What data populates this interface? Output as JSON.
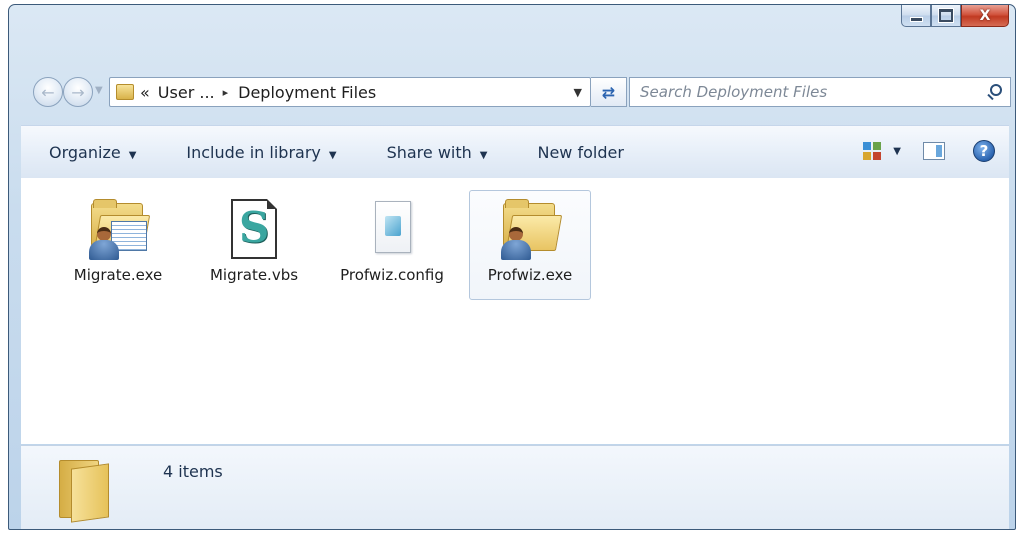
{
  "window": {
    "caption_buttons": {
      "minimize": "minimize",
      "maximize": "maximize",
      "close": "X"
    }
  },
  "navigation": {
    "back_icon": "back-arrow-icon",
    "forward_icon": "forward-arrow-icon",
    "address": {
      "prefix": "«",
      "segments": [
        "User ...",
        "Deployment Files"
      ],
      "separator": "▸"
    },
    "search": {
      "placeholder": "Search Deployment Files"
    }
  },
  "toolbar": {
    "organize": "Organize",
    "include_in_library": "Include in library",
    "share_with": "Share with",
    "new_folder": "New folder"
  },
  "files": [
    {
      "name": "Migrate.exe",
      "icon": "folder-person-doc-icon",
      "selected": false
    },
    {
      "name": "Migrate.vbs",
      "icon": "script-icon",
      "selected": false
    },
    {
      "name": "Profwiz.config",
      "icon": "config-file-icon",
      "selected": false
    },
    {
      "name": "Profwiz.exe",
      "icon": "folder-person-icon",
      "selected": true
    }
  ],
  "details": {
    "item_count": "4 items"
  },
  "colors": {
    "accent": "#2b64b0",
    "close_button": "#c13a22",
    "folder": "#e8c463"
  }
}
